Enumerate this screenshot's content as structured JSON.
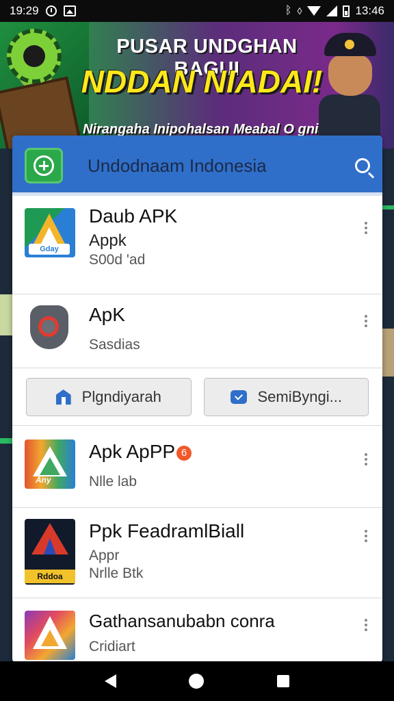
{
  "status_bar": {
    "time": "19:29",
    "clock": "13:46",
    "icons": [
      "alarm-icon",
      "image-icon",
      "bluetooth-icon",
      "vibrate-icon",
      "wifi-icon",
      "signal-icon",
      "battery-icon"
    ]
  },
  "banner": {
    "title_line1": "PUSAR UNDGHAN BAGUI",
    "title_line2": "NDDAN NIADAI!",
    "subtitle": "Nirangaha Inipohalsan Meabal O gnian?"
  },
  "app_bar": {
    "title": "Undodnaam Indonesia",
    "logo_icon": "plus-circle-icon",
    "search_icon": "search-icon",
    "color": "#2f6fc9"
  },
  "list": {
    "items": [
      {
        "name": "Daub APK",
        "line1": "Apрk",
        "line2": "S00d 'ad",
        "thumb_label": "Gday",
        "icon": "app-icon-triangle-green"
      },
      {
        "name": "ApK",
        "line1": "",
        "line2": "Sasdias",
        "icon": "shield-icon"
      }
    ],
    "items_after": [
      {
        "name": "Apk ApPP",
        "badge": "6",
        "line1": "",
        "line2": "Nlle lab",
        "thumb_label": "Any",
        "icon": "app-icon-triangle-multicolor"
      },
      {
        "name": "Ppk FeadramlBiall",
        "line1": "Appr",
        "line2": "Nrlle Btk",
        "thumb_label": "Rddoa",
        "icon": "app-icon-triangle-dark"
      },
      {
        "name": "Gathansanubabn conra",
        "line1": "",
        "line2": "Cridiart",
        "icon": "app-icon-triangle-color"
      }
    ]
  },
  "buttons": {
    "left_label": "Plgndiyarah",
    "right_label": "SemiByngi..."
  },
  "nav_bar": {
    "icons": [
      "back-icon",
      "home-icon",
      "recents-icon"
    ]
  }
}
